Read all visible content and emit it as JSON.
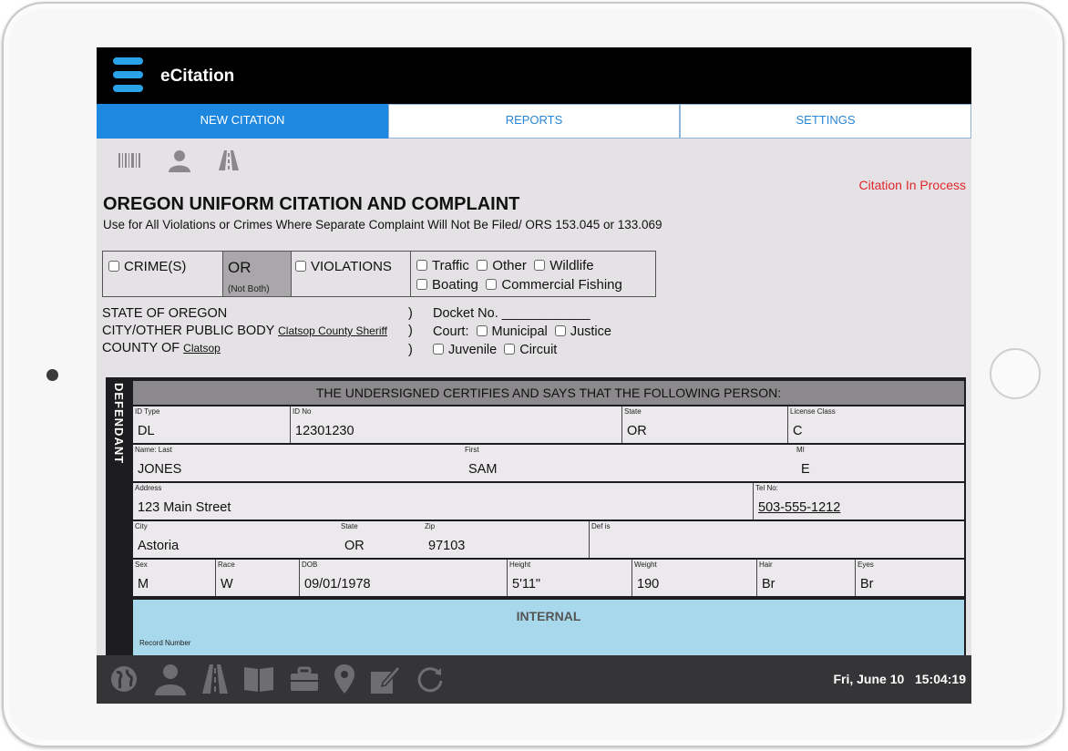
{
  "app": {
    "title": "eCitation"
  },
  "tabs": [
    {
      "label": "NEW CITATION",
      "active": true
    },
    {
      "label": "REPORTS",
      "active": false
    },
    {
      "label": "SETTINGS",
      "active": false
    }
  ],
  "toolbar_icons": [
    "barcode-icon",
    "person-icon",
    "road-icon"
  ],
  "status": "Citation In Process",
  "form": {
    "title": "OREGON UNIFORM CITATION AND COMPLAINT",
    "subtitle": "Use for All Violations or Crimes Where Separate Complaint Will Not Be Filed/ ORS 153.045 or 133.069",
    "crime_label": "CRIME(S)",
    "or_label": "OR",
    "not_both": "(Not Both)",
    "violations_label": "VIOLATIONS",
    "types": {
      "traffic": "Traffic",
      "other": "Other",
      "wildlife": "Wildlife",
      "boating": "Boating",
      "commercial_fishing": "Commercial Fishing"
    }
  },
  "jurisdiction": {
    "state": "STATE OF OREGON",
    "city_label": "CITY/OTHER PUBLIC BODY",
    "city_value": "Clatsop County Sheriff",
    "county_label": "COUNTY OF",
    "county_value": "Clatsop",
    "paren": ")",
    "docket_label": "Docket No. ____________",
    "court_label": "Court:",
    "municipal": "Municipal",
    "justice": "Justice",
    "juvenile": "Juvenile",
    "circuit": "Circuit"
  },
  "defendant": {
    "side_label": "DEFENDANT",
    "header": "THE UNDERSIGNED CERTIFIES AND SAYS THAT THE FOLLOWING PERSON:",
    "labels": {
      "id_type": "ID Type",
      "id_no": "ID No",
      "state": "State",
      "license_class": "License Class",
      "name_last": "Name: Last",
      "first": "First",
      "mi": "MI",
      "address": "Address",
      "tel": "Tel No:",
      "city": "City",
      "city_state": "State",
      "zip": "Zip",
      "def_is": "Def is",
      "sex": "Sex",
      "race": "Race",
      "dob": "DOB",
      "height": "Height",
      "weight": "Weight",
      "hair": "Hair",
      "eyes": "Eyes"
    },
    "values": {
      "id_type": "DL",
      "id_no": "12301230",
      "state": "OR",
      "license_class": "C",
      "last": "JONES",
      "first": "SAM",
      "mi": "E",
      "address": "123 Main Street",
      "tel": "503-555-1212",
      "city": "Astoria",
      "city_state": "OR",
      "zip": "97103",
      "def_is": "",
      "sex": "M",
      "race": "W",
      "dob": "09/01/1978",
      "height": "5'11\"",
      "weight": "190",
      "hair": "Br",
      "eyes": "Br"
    },
    "internal": "INTERNAL",
    "record_number": "Record Number"
  },
  "bottom_icons": [
    "globe-icon",
    "person-icon",
    "road-icon",
    "book-icon",
    "briefcase-icon",
    "map-pin-icon",
    "edit-icon",
    "refresh-icon"
  ],
  "datetime": {
    "date": "Fri, June 10",
    "time": "15:04:19"
  },
  "colors": {
    "accent": "#1e88e0",
    "status": "#e0262c",
    "internal": "#a8d8ec"
  }
}
